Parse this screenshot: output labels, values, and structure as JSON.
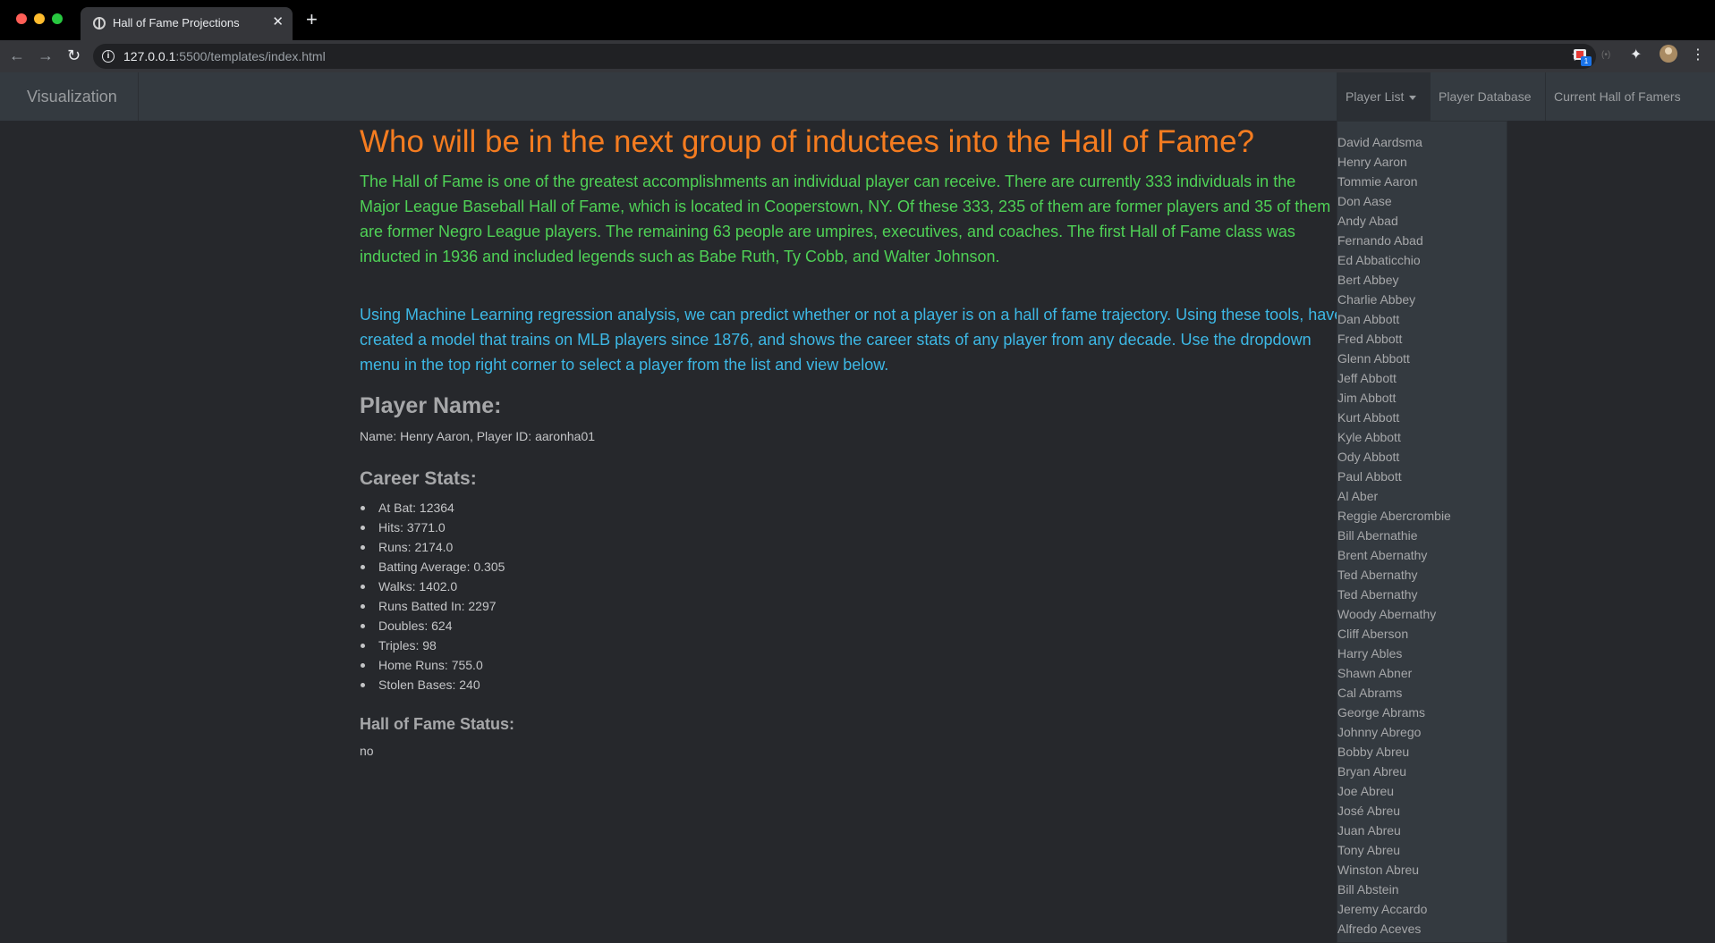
{
  "browser": {
    "tab_title": "Hall of Fame Projections",
    "url_host": "127.0.0.1",
    "url_rest": ":5500/templates/index.html",
    "extension_badge": "1"
  },
  "navbar": {
    "brand": "Visualization",
    "links": {
      "player_list": "Player List",
      "player_database": "Player Database",
      "current_hof": "Current Hall of Famers"
    }
  },
  "main": {
    "heading": "Who will be in the next group of inductees into the Hall of Fame?",
    "intro": "The Hall of Fame is one of the greatest accomplishments an individual player can receive. There are currently 333 individuals in the Major League Baseball Hall of Fame, which is located in Cooperstown, NY. Of these 333, 235 of them are former players and 35 of them are former Negro League players. The remaining 63 people are umpires, executives, and coaches. The first Hall of Fame class was inducted in 1936 and included legends such as Babe Ruth, Ty Cobb, and Walter Johnson.",
    "ml_text": "Using Machine Learning regression analysis, we can predict whether or not a player is on a hall of fame trajectory. Using these tools, have created a model that trains on MLB players since 1876, and shows the career stats of any player from any decade. Use the dropdown menu in the top right corner to select a player from the list and view below.",
    "player_heading": "Player Name:",
    "player_line": "Name: Henry Aaron, Player ID: aaronha01",
    "career_heading": "Career Stats:",
    "stats": [
      "At Bat: 12364",
      "Hits: 3771.0",
      "Runs: 2174.0",
      "Batting Average: 0.305",
      "Walks: 1402.0",
      "Runs Batted In: 2297",
      "Doubles: 624",
      "Triples: 98",
      "Home Runs: 755.0",
      "Stolen Bases: 240"
    ],
    "hof_heading": "Hall of Fame Status:",
    "hof_value": "no"
  },
  "player_list": [
    "David Aardsma",
    "Henry Aaron",
    "Tommie Aaron",
    "Don Aase",
    "Andy Abad",
    "Fernando Abad",
    "Ed Abbaticchio",
    "Bert Abbey",
    "Charlie Abbey",
    "Dan Abbott",
    "Fred Abbott",
    "Glenn Abbott",
    "Jeff Abbott",
    "Jim Abbott",
    "Kurt Abbott",
    "Kyle Abbott",
    "Ody Abbott",
    "Paul Abbott",
    "Al Aber",
    "Reggie Abercrombie",
    "Bill Abernathie",
    "Brent Abernathy",
    "Ted Abernathy",
    "Ted Abernathy",
    "Woody Abernathy",
    "Cliff Aberson",
    "Harry Ables",
    "Shawn Abner",
    "Cal Abrams",
    "George Abrams",
    "Johnny Abrego",
    "Bobby Abreu",
    "Bryan Abreu",
    "Joe Abreu",
    "José Abreu",
    "Juan Abreu",
    "Tony Abreu",
    "Winston Abreu",
    "Bill Abstein",
    "Jeremy Accardo",
    "Alfredo Aceves"
  ]
}
